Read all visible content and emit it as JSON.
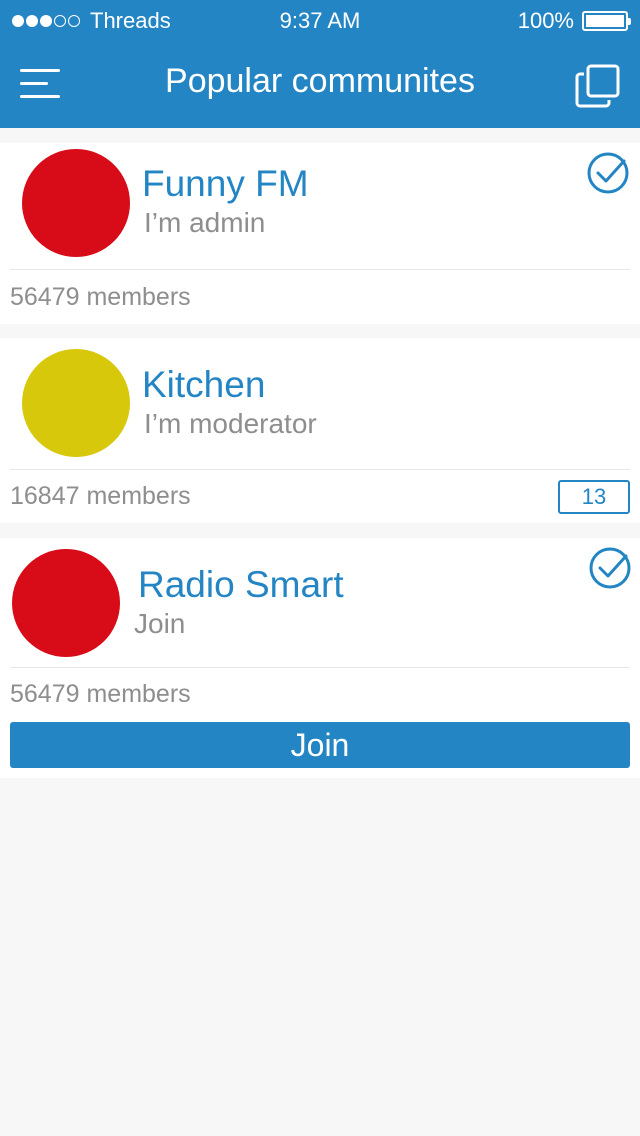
{
  "status_bar": {
    "carrier": "Threads",
    "time": "9:37 AM",
    "battery": "100%",
    "signal_filled": 3,
    "signal_total": 5
  },
  "nav": {
    "title": "Popular communites",
    "menu_icon": "menu-icon",
    "right_icon": "windows-icon"
  },
  "colors": {
    "primary": "#2385c4",
    "red": "#d80c18",
    "yellow": "#d8c80c",
    "gray_text": "#8e8e8e"
  },
  "communities": [
    {
      "name": "Funny FM",
      "role": "I’m admin",
      "members": "56479 members",
      "avatar_color": "#d80c18",
      "checked": true
    },
    {
      "name": "Kitchen",
      "role": "I’m moderator",
      "members": "16847 members",
      "avatar_color": "#d8c80c",
      "badge": "13"
    },
    {
      "name": "Radio Smart",
      "role": "Join",
      "members": "56479 members",
      "avatar_color": "#d80c18",
      "checked": true,
      "join_label": "Join"
    }
  ]
}
